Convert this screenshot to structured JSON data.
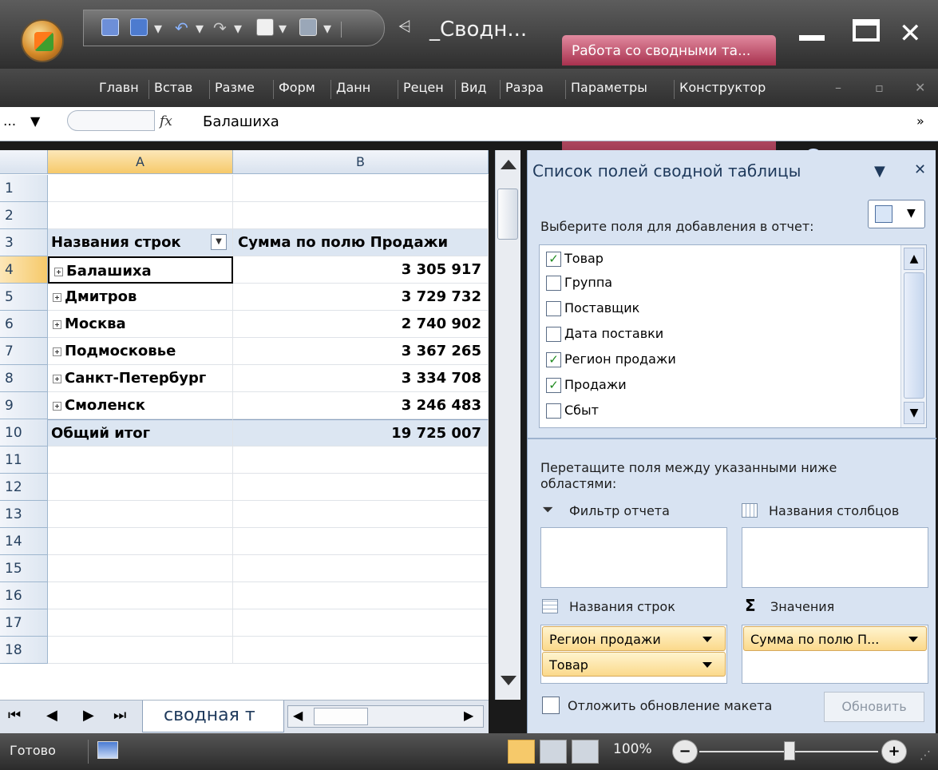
{
  "window": {
    "title": "_Сводн...",
    "context_tab": "Работа со сводными та..."
  },
  "ribbon": {
    "tabs": [
      "Главн",
      "Встав",
      "Разме",
      "Форм",
      "Данн",
      "Рецен",
      "Вид",
      "Разра"
    ],
    "context_tabs": [
      "Параметры",
      "Конструктор"
    ]
  },
  "formula_bar": {
    "name_box": "...",
    "fx": "fx",
    "value": "Балашиха"
  },
  "grid": {
    "columns": [
      "A",
      "B"
    ],
    "rows": [
      {
        "n": "1",
        "a": "",
        "b": ""
      },
      {
        "n": "2",
        "a": "",
        "b": ""
      },
      {
        "n": "3",
        "a": "Названия строк",
        "b": "Сумма по полю Продажи"
      },
      {
        "n": "4",
        "a": "Балашиха",
        "b": "3 305 917"
      },
      {
        "n": "5",
        "a": "Дмитров",
        "b": "3 729 732"
      },
      {
        "n": "6",
        "a": "Москва",
        "b": "2 740 902"
      },
      {
        "n": "7",
        "a": "Подмосковье",
        "b": "3 367 265"
      },
      {
        "n": "8",
        "a": "Санкт-Петербург",
        "b": "3 334 708"
      },
      {
        "n": "9",
        "a": "Смоленск",
        "b": "3 246 483"
      },
      {
        "n": "10",
        "a": "Общий итог",
        "b": "19 725 007"
      },
      {
        "n": "11",
        "a": "",
        "b": ""
      },
      {
        "n": "12",
        "a": "",
        "b": ""
      },
      {
        "n": "13",
        "a": "",
        "b": ""
      },
      {
        "n": "14",
        "a": "",
        "b": ""
      },
      {
        "n": "15",
        "a": "",
        "b": ""
      },
      {
        "n": "16",
        "a": "",
        "b": ""
      },
      {
        "n": "17",
        "a": "",
        "b": ""
      },
      {
        "n": "18",
        "a": "",
        "b": ""
      }
    ]
  },
  "sheet_tab": "сводная т",
  "status": {
    "ready": "Готово",
    "zoom": "100%"
  },
  "pivot_panel": {
    "title": "Список полей сводной таблицы",
    "choose_label": "Выберите поля для добавления в отчет:",
    "fields": [
      {
        "label": "Товар",
        "checked": true
      },
      {
        "label": "Группа",
        "checked": false
      },
      {
        "label": "Поставщик",
        "checked": false
      },
      {
        "label": "Дата поставки",
        "checked": false
      },
      {
        "label": "Регион продажи",
        "checked": true
      },
      {
        "label": "Продажи",
        "checked": true
      },
      {
        "label": "Сбыт",
        "checked": false
      }
    ],
    "drag_label": "Перетащите поля между указанными ниже областями:",
    "area_filter": "Фильтр отчета",
    "area_columns": "Названия столбцов",
    "area_rows": "Названия строк",
    "area_values": "Значения",
    "row_items": [
      "Регион продажи",
      "Товар"
    ],
    "value_items": [
      "Сумма по полю П..."
    ],
    "defer_label": "Отложить обновление макета",
    "update_button": "Обновить"
  }
}
